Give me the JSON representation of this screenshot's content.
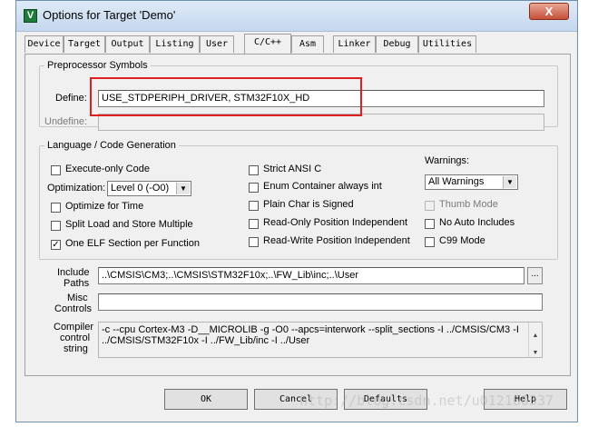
{
  "window": {
    "title": "Options for Target 'Demo'",
    "close_glyph": "X",
    "icon_glyph": "V"
  },
  "tabs": [
    "Device",
    "Target",
    "Output",
    "Listing",
    "User",
    "C/C++",
    "Asm",
    "Linker",
    "Debug",
    "Utilities"
  ],
  "active_tab": "C/C++",
  "preprocessor": {
    "legend": "Preprocessor Symbols",
    "define_label": "Define:",
    "define_value": "USE_STDPERIPH_DRIVER, STM32F10X_HD",
    "undefine_label": "Undefine:",
    "undefine_value": ""
  },
  "language": {
    "legend": "Language / Code Generation",
    "col1": [
      {
        "label": "Execute-only Code",
        "checked": false,
        "disabled": false
      },
      {
        "label": "Optimize for Time",
        "checked": false,
        "disabled": false
      },
      {
        "label": "Split Load and Store Multiple",
        "checked": false,
        "disabled": false
      },
      {
        "label": "One ELF Section per Function",
        "checked": true,
        "disabled": false
      }
    ],
    "optimization_label": "Optimization:",
    "optimization_value": "Level 0 (-O0)",
    "col2": [
      {
        "label": "Strict ANSI C",
        "checked": false,
        "disabled": false
      },
      {
        "label": "Enum Container always int",
        "checked": false,
        "disabled": false
      },
      {
        "label": "Plain Char is Signed",
        "checked": false,
        "disabled": false
      },
      {
        "label": "Read-Only Position Independent",
        "checked": false,
        "disabled": false
      },
      {
        "label": "Read-Write Position Independent",
        "checked": false,
        "disabled": false
      }
    ],
    "warnings_label": "Warnings:",
    "warnings_value": "All Warnings",
    "col3": [
      {
        "label": "Thumb Mode",
        "checked": false,
        "disabled": true
      },
      {
        "label": "No Auto Includes",
        "checked": false,
        "disabled": false
      },
      {
        "label": "C99 Mode",
        "checked": false,
        "disabled": false
      }
    ]
  },
  "include": {
    "label_line1": "Include",
    "label_line2": "Paths",
    "value": "..\\CMSIS\\CM3;..\\CMSIS\\STM32F10x;..\\FW_Lib\\inc;..\\User",
    "browse_label": "..."
  },
  "misc": {
    "label_line1": "Misc",
    "label_line2": "Controls",
    "value": ""
  },
  "compiler": {
    "label_line1": "Compiler",
    "label_line2": "control",
    "label_line3": "string",
    "line1": "-c --cpu Cortex-M3 -D__MICROLIB -g -O0 --apcs=interwork --split_sections -I ../CMSIS/CM3 -I",
    "line2": "../CMSIS/STM32F10x -I ../FW_Lib/inc -I ../User"
  },
  "buttons": {
    "ok": "OK",
    "cancel": "Cancel",
    "defaults": "Defaults",
    "help": "Help"
  },
  "watermark": "http://blog.csdn.net/u012160337"
}
